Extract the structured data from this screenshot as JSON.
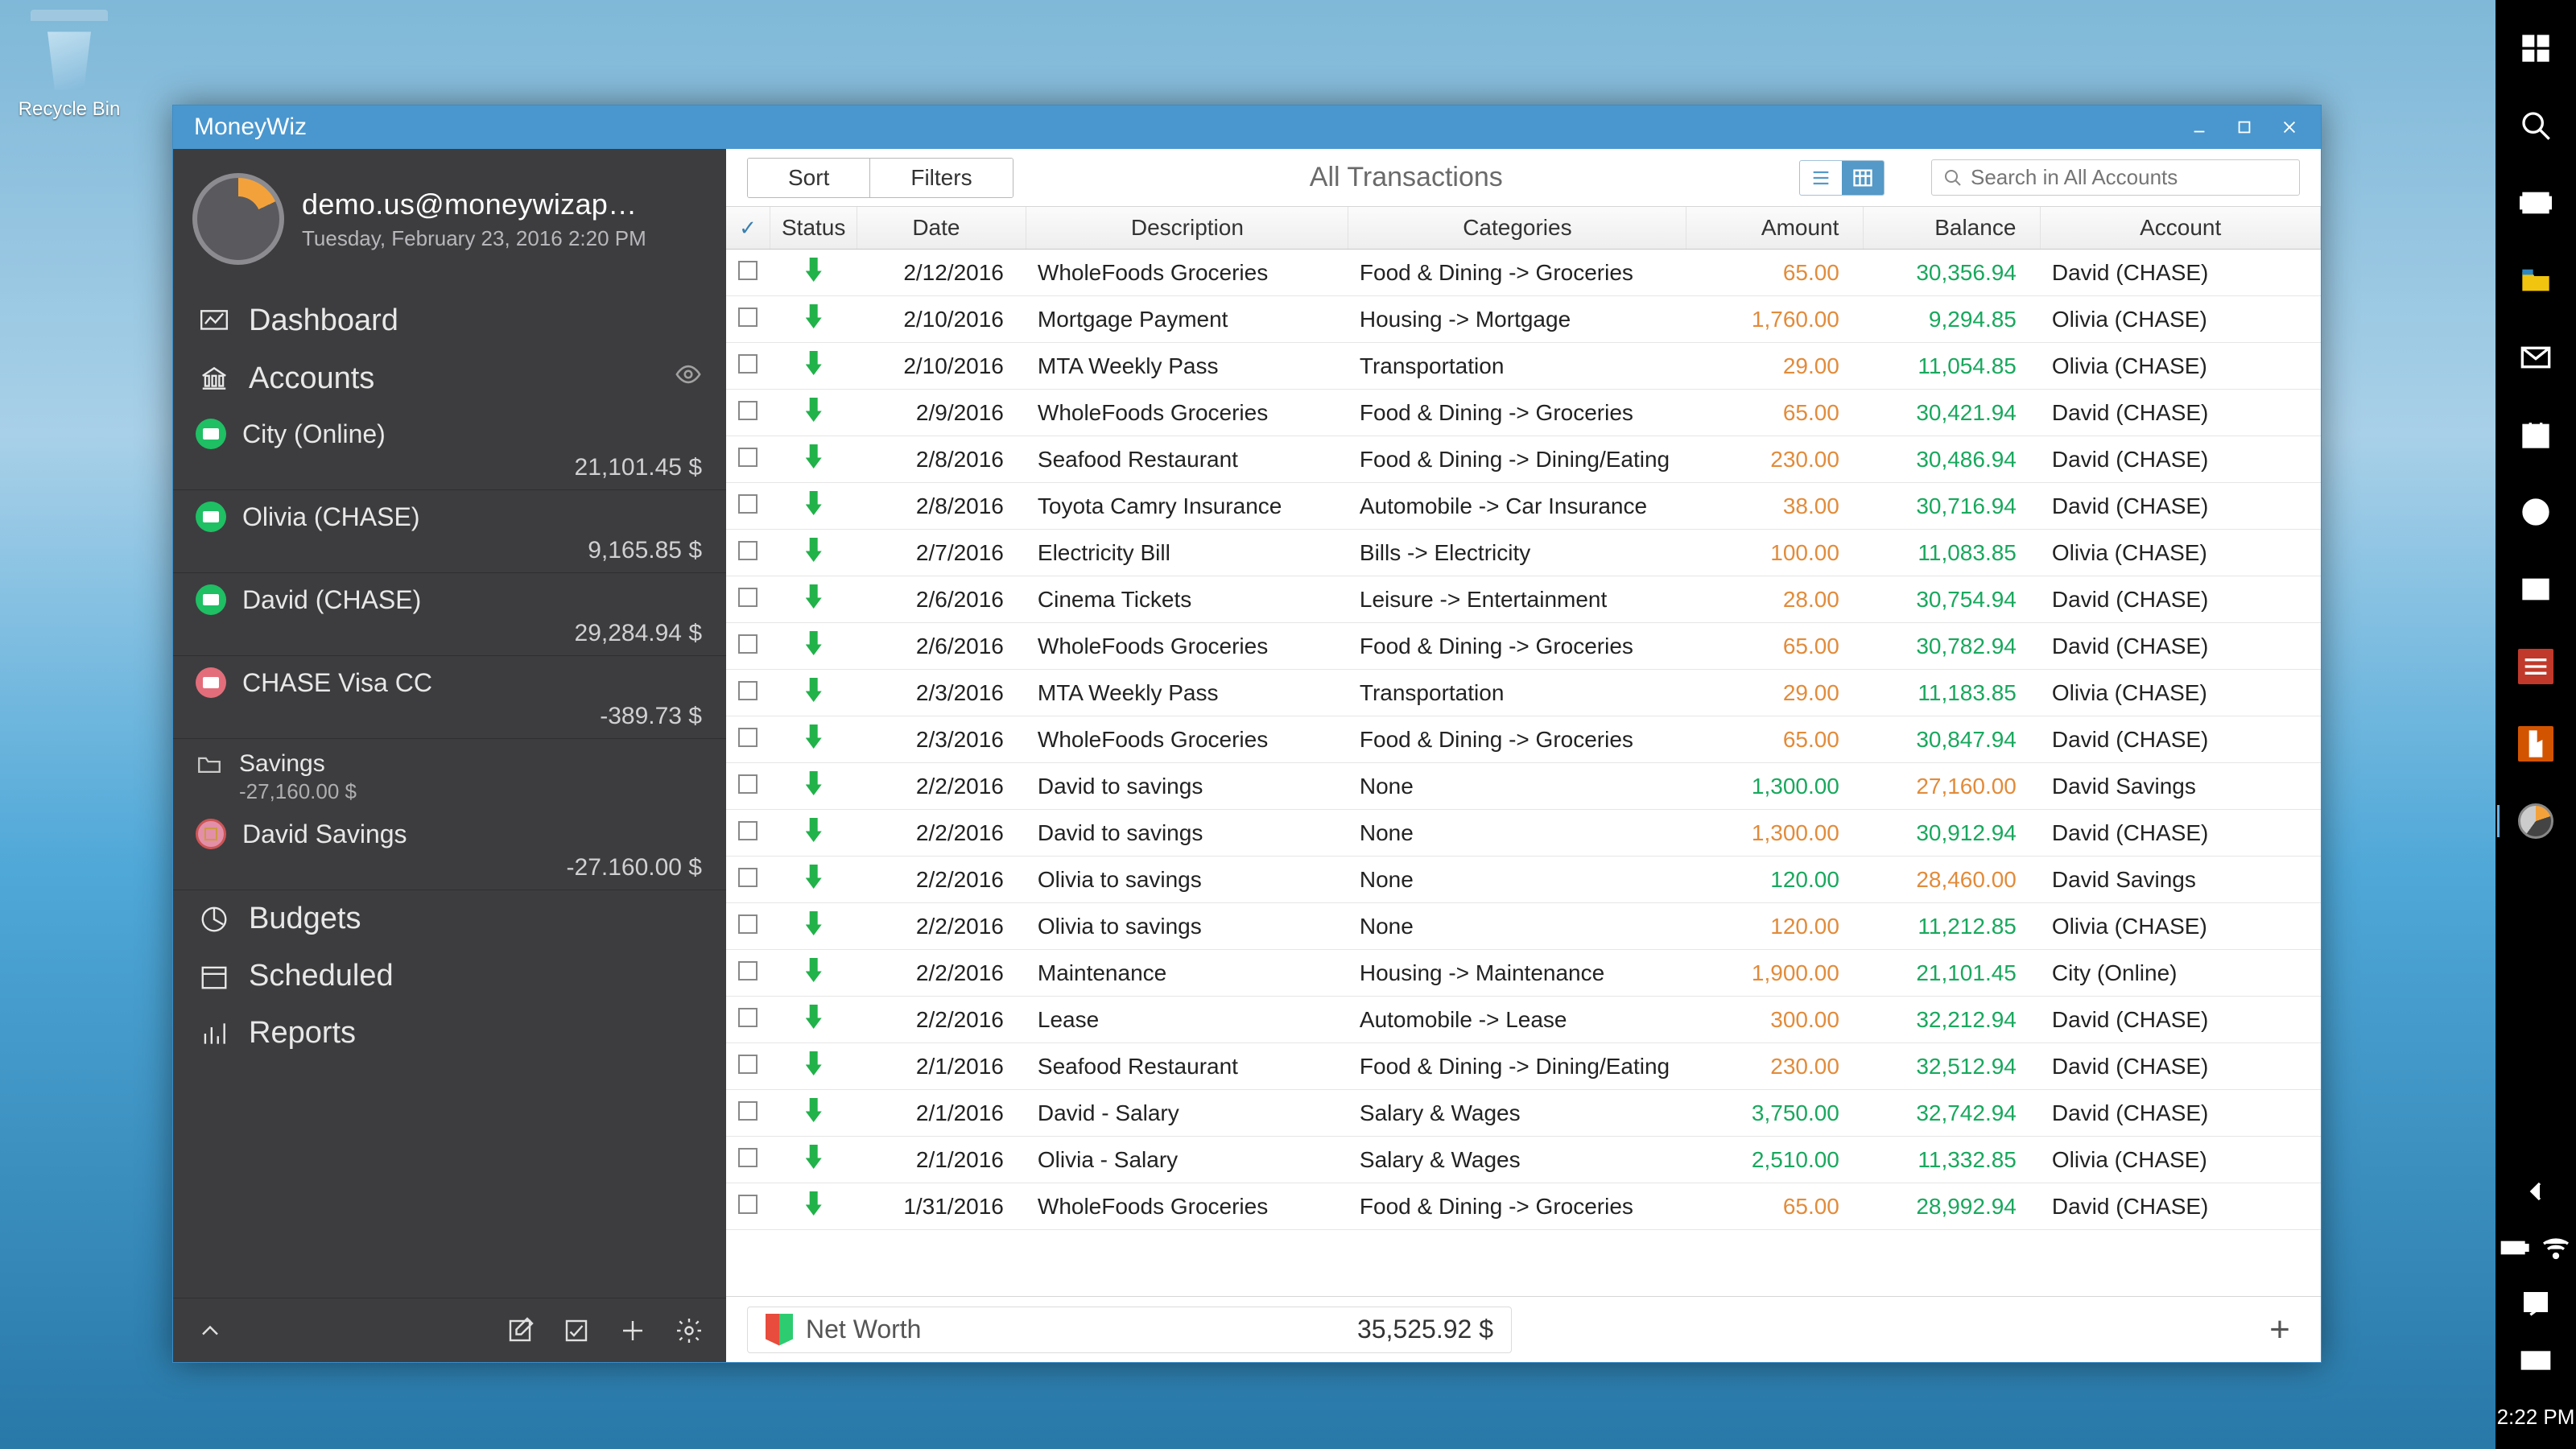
{
  "desktop": {
    "recycle_bin": "Recycle Bin"
  },
  "taskbar": {
    "clock": "2:22 PM"
  },
  "window": {
    "title": "MoneyWiz"
  },
  "profile": {
    "email": "demo.us@moneywizap…",
    "timestamp": "Tuesday, February 23, 2016 2:20 PM"
  },
  "nav": {
    "dashboard": "Dashboard",
    "accounts": "Accounts",
    "budgets": "Budgets",
    "scheduled": "Scheduled",
    "reports": "Reports"
  },
  "accounts": [
    {
      "name": "City (Online)",
      "balance": "21,101.45 $",
      "icon": "green"
    },
    {
      "name": "Olivia (CHASE)",
      "balance": "9,165.85 $",
      "icon": "green"
    },
    {
      "name": "David (CHASE)",
      "balance": "29,284.94 $",
      "icon": "green"
    },
    {
      "name": "CHASE Visa CC",
      "balance": "-389.73 $",
      "icon": "red"
    }
  ],
  "savings_folder": {
    "name": "Savings",
    "balance": "-27,160.00 $"
  },
  "savings_child": {
    "name": "David Savings",
    "balance": "-27.160.00 $"
  },
  "toolbar": {
    "sort": "Sort",
    "filters": "Filters",
    "title": "All Transactions",
    "search_placeholder": "Search in All Accounts"
  },
  "columns": {
    "status": "Status",
    "date": "Date",
    "description": "Description",
    "categories": "Categories",
    "amount": "Amount",
    "balance": "Balance",
    "account": "Account"
  },
  "rows": [
    {
      "date": "2/12/2016",
      "desc": "WholeFoods Groceries",
      "cat": "Food & Dining -> Groceries",
      "amt": "65.00",
      "amt_cls": "neg",
      "bal": "30,356.94",
      "bal_cls": "pos",
      "acct": "David (CHASE)"
    },
    {
      "date": "2/10/2016",
      "desc": "Mortgage Payment",
      "cat": "Housing -> Mortgage",
      "amt": "1,760.00",
      "amt_cls": "neg",
      "bal": "9,294.85",
      "bal_cls": "pos",
      "acct": "Olivia (CHASE)"
    },
    {
      "date": "2/10/2016",
      "desc": "MTA Weekly Pass",
      "cat": "Transportation",
      "amt": "29.00",
      "amt_cls": "neg",
      "bal": "11,054.85",
      "bal_cls": "pos",
      "acct": "Olivia (CHASE)"
    },
    {
      "date": "2/9/2016",
      "desc": "WholeFoods Groceries",
      "cat": "Food & Dining -> Groceries",
      "amt": "65.00",
      "amt_cls": "neg",
      "bal": "30,421.94",
      "bal_cls": "pos",
      "acct": "David (CHASE)"
    },
    {
      "date": "2/8/2016",
      "desc": "Seafood Restaurant",
      "cat": "Food & Dining -> Dining/Eating",
      "amt": "230.00",
      "amt_cls": "neg",
      "bal": "30,486.94",
      "bal_cls": "pos",
      "acct": "David (CHASE)"
    },
    {
      "date": "2/8/2016",
      "desc": "Toyota Camry Insurance",
      "cat": "Automobile -> Car Insurance",
      "amt": "38.00",
      "amt_cls": "neg",
      "bal": "30,716.94",
      "bal_cls": "pos",
      "acct": "David (CHASE)"
    },
    {
      "date": "2/7/2016",
      "desc": "Electricity Bill",
      "cat": "Bills -> Electricity",
      "amt": "100.00",
      "amt_cls": "neg",
      "bal": "11,083.85",
      "bal_cls": "pos",
      "acct": "Olivia (CHASE)"
    },
    {
      "date": "2/6/2016",
      "desc": "Cinema Tickets",
      "cat": "Leisure -> Entertainment",
      "amt": "28.00",
      "amt_cls": "neg",
      "bal": "30,754.94",
      "bal_cls": "pos",
      "acct": "David (CHASE)"
    },
    {
      "date": "2/6/2016",
      "desc": "WholeFoods Groceries",
      "cat": "Food & Dining -> Groceries",
      "amt": "65.00",
      "amt_cls": "neg",
      "bal": "30,782.94",
      "bal_cls": "pos",
      "acct": "David (CHASE)"
    },
    {
      "date": "2/3/2016",
      "desc": "MTA Weekly Pass",
      "cat": "Transportation",
      "amt": "29.00",
      "amt_cls": "neg",
      "bal": "11,183.85",
      "bal_cls": "pos",
      "acct": "Olivia (CHASE)"
    },
    {
      "date": "2/3/2016",
      "desc": "WholeFoods Groceries",
      "cat": "Food & Dining -> Groceries",
      "amt": "65.00",
      "amt_cls": "neg",
      "bal": "30,847.94",
      "bal_cls": "pos",
      "acct": "David (CHASE)"
    },
    {
      "date": "2/2/2016",
      "desc": "David to savings",
      "cat": "None",
      "amt": "1,300.00",
      "amt_cls": "pos",
      "bal": "27,160.00",
      "bal_cls": "neg",
      "acct": "David Savings"
    },
    {
      "date": "2/2/2016",
      "desc": "David to savings",
      "cat": "None",
      "amt": "1,300.00",
      "amt_cls": "neg",
      "bal": "30,912.94",
      "bal_cls": "pos",
      "acct": "David (CHASE)"
    },
    {
      "date": "2/2/2016",
      "desc": "Olivia to savings",
      "cat": "None",
      "amt": "120.00",
      "amt_cls": "pos",
      "bal": "28,460.00",
      "bal_cls": "neg",
      "acct": "David Savings"
    },
    {
      "date": "2/2/2016",
      "desc": "Olivia to savings",
      "cat": "None",
      "amt": "120.00",
      "amt_cls": "neg",
      "bal": "11,212.85",
      "bal_cls": "pos",
      "acct": "Olivia (CHASE)"
    },
    {
      "date": "2/2/2016",
      "desc": "Maintenance",
      "cat": "Housing -> Maintenance",
      "amt": "1,900.00",
      "amt_cls": "neg",
      "bal": "21,101.45",
      "bal_cls": "pos",
      "acct": "City (Online)"
    },
    {
      "date": "2/2/2016",
      "desc": "Lease",
      "cat": "Automobile -> Lease",
      "amt": "300.00",
      "amt_cls": "neg",
      "bal": "32,212.94",
      "bal_cls": "pos",
      "acct": "David (CHASE)"
    },
    {
      "date": "2/1/2016",
      "desc": "Seafood Restaurant",
      "cat": "Food & Dining -> Dining/Eating",
      "amt": "230.00",
      "amt_cls": "neg",
      "bal": "32,512.94",
      "bal_cls": "pos",
      "acct": "David (CHASE)"
    },
    {
      "date": "2/1/2016",
      "desc": "David - Salary",
      "cat": "Salary & Wages",
      "amt": "3,750.00",
      "amt_cls": "pos",
      "bal": "32,742.94",
      "bal_cls": "pos",
      "acct": "David (CHASE)"
    },
    {
      "date": "2/1/2016",
      "desc": "Olivia - Salary",
      "cat": "Salary & Wages",
      "amt": "2,510.00",
      "amt_cls": "pos",
      "bal": "11,332.85",
      "bal_cls": "pos",
      "acct": "Olivia (CHASE)"
    },
    {
      "date": "1/31/2016",
      "desc": "WholeFoods Groceries",
      "cat": "Food & Dining -> Groceries",
      "amt": "65.00",
      "amt_cls": "neg",
      "bal": "28,992.94",
      "bal_cls": "pos",
      "acct": "David (CHASE)"
    }
  ],
  "footer": {
    "label": "Net Worth",
    "value": "35,525.92 $"
  }
}
